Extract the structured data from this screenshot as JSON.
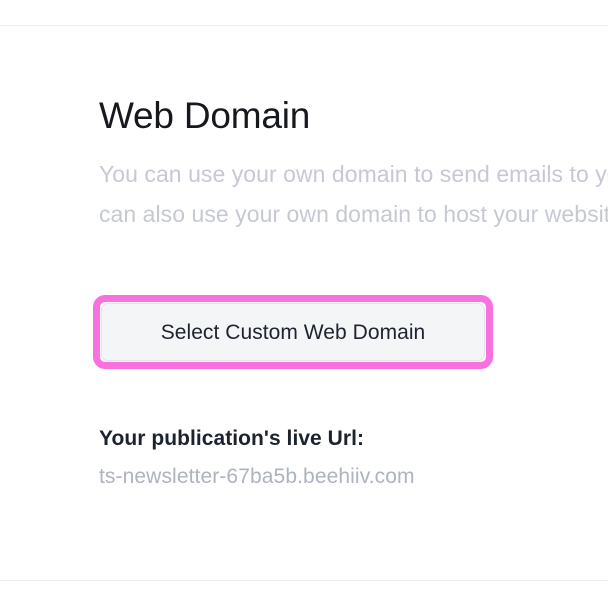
{
  "panel": {
    "title": "Web Domain",
    "description_lines": [
      "You can use your own domain to send emails to your subscribers. You",
      "can also use your own domain to host your website on beehiiv. You"
    ]
  },
  "action": {
    "select_domain_label": "Select Custom Web Domain",
    "highlight_color": "#f871df",
    "button_fill": "#f4f5f7",
    "button_text_color": "#1d232e"
  },
  "live_url": {
    "label": "Your publication's live Url:",
    "value": "ts-newsletter-67ba5b.beehiiv.com",
    "value_color": "#aeb3c0"
  },
  "dividers": {
    "color": "#eceef2"
  }
}
